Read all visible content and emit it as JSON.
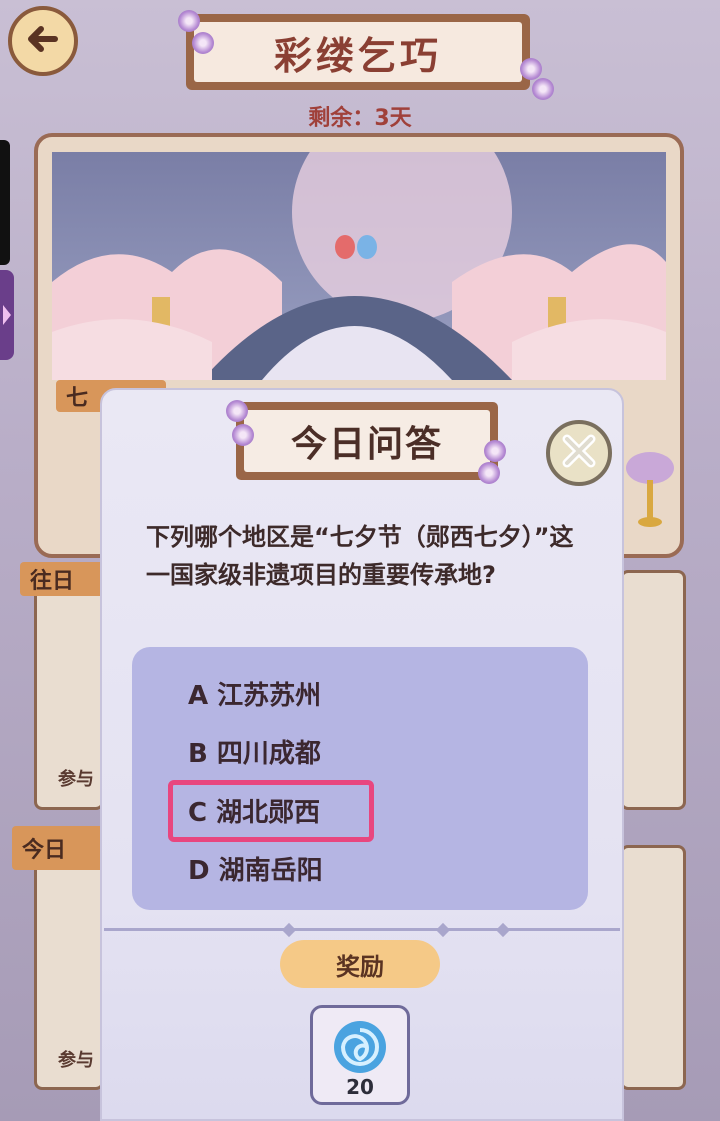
{
  "header": {
    "title": "彩缕乞巧",
    "remaining": "剩余：3天"
  },
  "background": {
    "tag_1": "七",
    "card_tag_1": "往日",
    "card_tag_2": "今日",
    "card_text_1": "参与",
    "card_text_2": "参与"
  },
  "dialog": {
    "title": "今日问答",
    "question": "下列哪个地区是“七夕节（郧西七夕）”这一国家级非遗项目的重要传承地?",
    "options": [
      {
        "label": "A 江苏苏州"
      },
      {
        "label": "B 四川成都"
      },
      {
        "label": "C 湖北郧西"
      },
      {
        "label": "D 湖南岳阳"
      }
    ],
    "selected_option": "C",
    "reward_label": "奖励",
    "reward_count": "20",
    "reward_icon": "blue-swirl-orb-icon"
  },
  "colors": {
    "highlight": "#e8467f",
    "options_bg": "#b5b5e3",
    "reward_pill": "#f5c987"
  }
}
